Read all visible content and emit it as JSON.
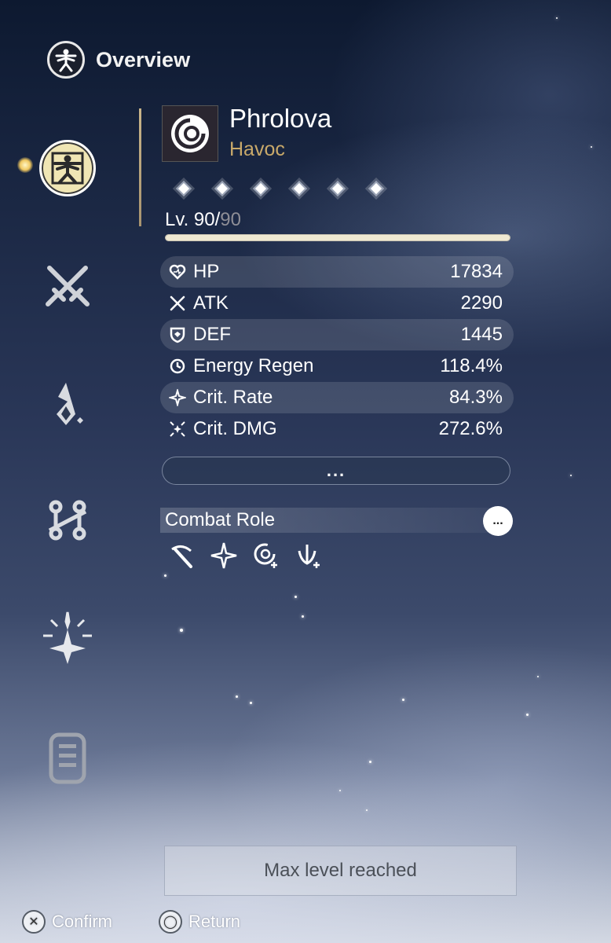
{
  "header": {
    "title": "Overview",
    "icon": "vitruvian-icon"
  },
  "sidebar": {
    "items": [
      {
        "name": "attributes",
        "icon": "vitruvian-icon",
        "active": true
      },
      {
        "name": "weapon",
        "icon": "crossed-swords-icon",
        "active": false
      },
      {
        "name": "echoes",
        "icon": "flame-diamond-icon",
        "active": false
      },
      {
        "name": "forte",
        "icon": "nodes-icon",
        "active": false
      },
      {
        "name": "resonance-chain",
        "icon": "sparkle-cluster-icon",
        "active": false
      },
      {
        "name": "profile",
        "icon": "tag-icon",
        "active": false
      }
    ]
  },
  "character": {
    "name": "Phrolova",
    "element": "Havoc",
    "stars": 6,
    "level": "90",
    "level_separator": "/",
    "max_level": "90",
    "level_prefix": "Lv. ",
    "level_progress": 1.0
  },
  "stats": [
    {
      "icon": "heart-icon",
      "name": "HP",
      "value": "17834"
    },
    {
      "icon": "crossed-swords-icon",
      "name": "ATK",
      "value": "2290"
    },
    {
      "icon": "shield-icon",
      "name": "DEF",
      "value": "1445"
    },
    {
      "icon": "energy-icon",
      "name": "Energy Regen",
      "value": "118.4%"
    },
    {
      "icon": "sparkle-icon",
      "name": "Crit. Rate",
      "value": "84.3%"
    },
    {
      "icon": "burst-icon",
      "name": "Crit. DMG",
      "value": "272.6%"
    }
  ],
  "more_button": "...",
  "combat_role": {
    "title": "Combat Role",
    "info": "...",
    "icons": [
      "scythe-icon",
      "four-point-star-icon",
      "spiral-plus-icon",
      "claw-plus-icon"
    ]
  },
  "footer": {
    "max_button": "Max level reached",
    "confirm_key": "✕",
    "confirm_label": "Confirm",
    "return_key": "◯",
    "return_label": "Return"
  },
  "colors": {
    "accent_gold": "#c9a96a",
    "active_tab": "#f0e6b4",
    "level_fill": "#efe9d2"
  }
}
